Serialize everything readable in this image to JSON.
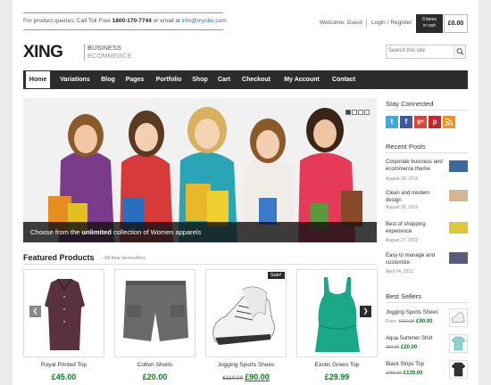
{
  "topbar": {
    "info_prefix": "For product queries: Call Toll Free",
    "phone": "1800-170-7744",
    "info_mid": "or email at",
    "email": "info@mysite.com",
    "welcome": "Welcome, Guest",
    "login": "Login / Register",
    "cart_count": "0 items",
    "cart_label": "in cart",
    "cart_total": "£0.00"
  },
  "brand": {
    "logo": "XING",
    "tag1": "BUSINESS",
    "tag2": "ECOMMERCE"
  },
  "search": {
    "placeholder": "Search this site"
  },
  "nav": [
    "Home",
    "Variations",
    "Blog",
    "Pages",
    "Portfolio",
    "Shop",
    "Cart",
    "Checkout",
    "My Account",
    "Contact"
  ],
  "hero": {
    "caption_pre": "Choose from the",
    "caption_bold": "unlimited",
    "caption_post": "collection of Women apparels",
    "slide_count": 4,
    "active_slide": 1
  },
  "featured": {
    "title": "Featured Products",
    "subtitle": "- All time bestsellers",
    "sale_badge": "Sale!",
    "products": [
      {
        "name": "Royal Printed Top",
        "price": "£45.00",
        "old": ""
      },
      {
        "name": "Cotton Shorts",
        "price": "£20.00",
        "old": ""
      },
      {
        "name": "Jogging Sports Shoes",
        "price": "£90.00",
        "old": "£110.00"
      },
      {
        "name": "Exotic Green Top",
        "price": "£29.99",
        "old": ""
      }
    ]
  },
  "sidebar": {
    "connected_title": "Stay Connected",
    "social": [
      "t",
      "f",
      "g+",
      "p",
      "rss"
    ],
    "social_colors": [
      "#3fa9e0",
      "#3b5b9a",
      "#d64937",
      "#c8232c",
      "#f29222"
    ],
    "recent_title": "Recent Posts",
    "posts": [
      {
        "title": "Corporate business and ecommerce theme",
        "date": "August 28, 2012"
      },
      {
        "title": "Clean and modern design",
        "date": "August 28, 2012"
      },
      {
        "title": "Best of shopping experience",
        "date": "August 27, 2012"
      },
      {
        "title": "Easy to manage and customize",
        "date": "April 24, 2012"
      }
    ],
    "bestsellers_title": "Best Sellers",
    "bestsellers": [
      {
        "title": "Jogging Sports Shoes",
        "from": "From:",
        "old": "£110.00",
        "price": "£90.00"
      },
      {
        "title": "Aqua Summer Shirt",
        "from": "",
        "old": "£30.00",
        "price": "£20.00"
      },
      {
        "title": "Black Strips Top",
        "from": "",
        "old": "£150.00",
        "price": "£139.00"
      }
    ]
  }
}
